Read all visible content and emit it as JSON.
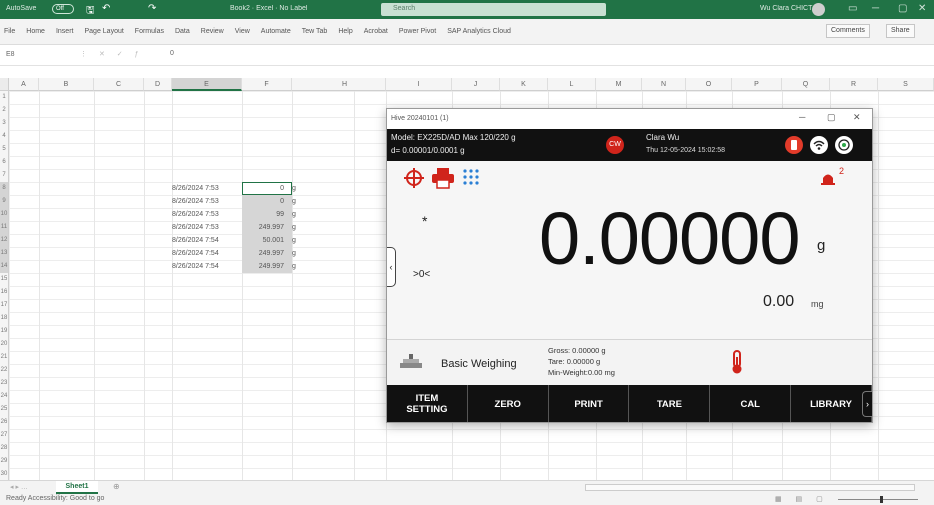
{
  "excel": {
    "autosave": "AutoSave",
    "autosave_state": "Off",
    "doc_title": "Book2 · Excel · No Label",
    "search_placeholder": "Search",
    "user_name": "Wu Clara CHICT",
    "tabs": [
      "File",
      "Home",
      "Insert",
      "Page Layout",
      "Formulas",
      "Data",
      "Review",
      "View",
      "Automate",
      "Tew Tab",
      "Help",
      "Acrobat",
      "Power Pivot",
      "SAP Analytics Cloud"
    ],
    "comments_label": "Comments",
    "share_label": "Share",
    "name_box": "E8",
    "formula_value": "0",
    "columns": [
      "A",
      "B",
      "C",
      "D",
      "E",
      "F",
      "G",
      "H",
      "I",
      "J",
      "K",
      "L",
      "M",
      "N",
      "O",
      "P",
      "Q",
      "R",
      "S"
    ],
    "rows": [
      "1",
      "2",
      "3",
      "4",
      "5",
      "6",
      "7",
      "8",
      "9",
      "10",
      "11",
      "12",
      "13",
      "14",
      "15",
      "16",
      "17",
      "18",
      "19",
      "20",
      "21",
      "22",
      "23",
      "24",
      "25",
      "26",
      "27",
      "28",
      "29",
      "30"
    ],
    "data_rows": [
      {
        "date": "8/26/2024 7:53",
        "value": "0",
        "unit": "g"
      },
      {
        "date": "8/26/2024 7:53",
        "value": "0",
        "unit": "g"
      },
      {
        "date": "8/26/2024 7:53",
        "value": "99",
        "unit": "g"
      },
      {
        "date": "8/26/2024 7:53",
        "value": "249.997",
        "unit": "g"
      },
      {
        "date": "8/26/2024 7:54",
        "value": "50.001",
        "unit": "g"
      },
      {
        "date": "8/26/2024 7:54",
        "value": "249.997",
        "unit": "g"
      },
      {
        "date": "8/26/2024 7:54",
        "value": "249.997",
        "unit": "g"
      }
    ],
    "sheet_name": "Sheet1",
    "status": "Ready  Accessibility: Good to go"
  },
  "balance": {
    "window_title": "Hive 20240101 (1)",
    "model": "Model: EX225D/AD   Max 120/220 g",
    "d_value": "d= 0.00001/0.0001 g",
    "user_initials": "CW",
    "user_name": "Clara Wu",
    "datetime": "Thu 12-05-2024 15:02:58",
    "alarm_count": "2",
    "stability_mark": "*",
    "zero_indicator": ">0<",
    "reading": "0.00000",
    "reading_unit": "g",
    "sub_reading": "0.00",
    "sub_unit": "mg",
    "mode": "Basic Weighing",
    "gross": "Gross: 0.00000 g",
    "tare": "Tare: 0.00000 g",
    "min_weight": "Min-Weight:0.00 mg",
    "softkeys": [
      "ITEM SETTING",
      "ZERO",
      "PRINT",
      "TARE",
      "CAL",
      "LIBRARY"
    ],
    "icons": [
      "crosshair-icon",
      "printer-icon",
      "grid-dots-icon",
      "alarm-light-icon",
      "bluetooth-icon",
      "wifi-icon",
      "level-icon",
      "scale-icon",
      "thermometer-icon"
    ],
    "accent_red": "#d0241b",
    "accent_blue": "#2a7fd4"
  }
}
